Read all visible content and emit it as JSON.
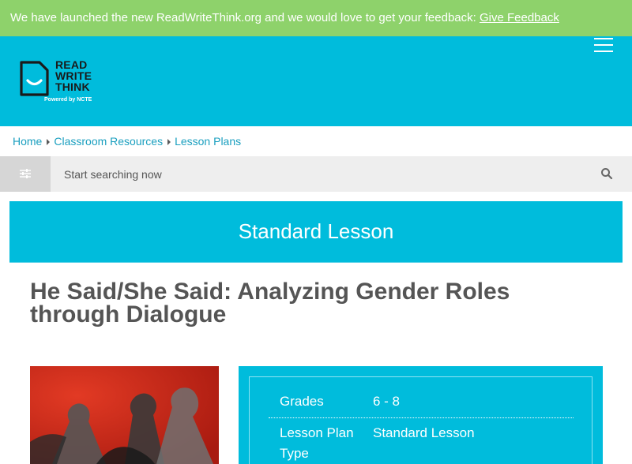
{
  "banner": {
    "text": "We have launched the new ReadWriteThink.org and we would love to get your feedback: ",
    "link_label": "Give Feedback"
  },
  "header": {
    "logo": {
      "line1": "READ",
      "line2": "WRITE",
      "line3": "THINK",
      "tagline": "Powered by NCTE"
    },
    "menu_icon": "hamburger-menu-icon"
  },
  "breadcrumb": [
    "Home",
    "Classroom Resources",
    "Lesson Plans"
  ],
  "search": {
    "placeholder": "Start searching now",
    "filter_icon": "sliders-icon",
    "search_icon": "magnifier-icon"
  },
  "lesson_type_banner": "Standard Lesson",
  "lesson": {
    "title": "He Said/She Said: Analyzing Gender Roles through Dialogue",
    "info": [
      {
        "label": "Grades",
        "value": "6 - 8"
      },
      {
        "label": "Lesson Plan Type",
        "value": "Standard Lesson"
      }
    ]
  },
  "colors": {
    "banner": "#8ed26b",
    "brand": "#00bcdc",
    "link": "#1a9fbf",
    "title": "#555555"
  }
}
